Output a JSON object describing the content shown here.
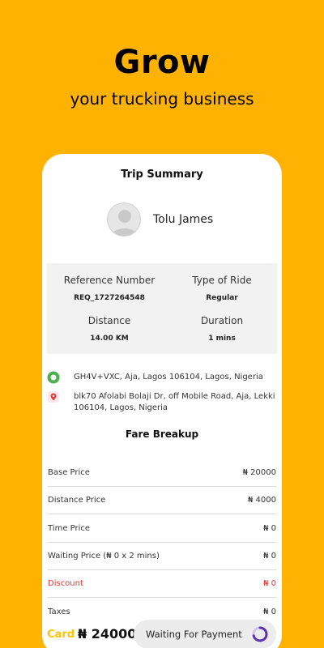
{
  "promo": {
    "headline": "Grow",
    "subline": "your trucking business"
  },
  "trip": {
    "title": "Trip Summary",
    "rider_name": "Tolu James",
    "details": {
      "reference_label": "Reference Number",
      "reference_value": "REQ_1727264548",
      "ride_type_label": "Type of Ride",
      "ride_type_value": "Regular",
      "distance_label": "Distance",
      "distance_value": "14.00 KM",
      "duration_label": "Duration",
      "duration_value": "1 mins"
    },
    "pickup": "GH4V+VXC, Aja, Lagos 106104, Lagos, Nigeria",
    "dropoff": "blk70 Afolabi Bolaji Dr, off Mobile Road, Aja, Lekki 106104, Lagos, Nigeria"
  },
  "fare": {
    "title": "Fare Breakup",
    "rows": [
      {
        "label": "Base Price",
        "value": "₦ 20000"
      },
      {
        "label": "Distance Price",
        "value": "₦ 4000"
      },
      {
        "label": "Time Price",
        "value": "₦ 0"
      },
      {
        "label": "Waiting Price (₦ 0 x 2 mins)",
        "value": "₦ 0"
      },
      {
        "label": "Discount",
        "value": "₦ 0"
      },
      {
        "label": "Taxes",
        "value": "₦ 0"
      }
    ]
  },
  "payment": {
    "method": "Card",
    "total": "₦ 24000",
    "status_label": "Waiting For Payment"
  },
  "colors": {
    "background": "#FFB300",
    "card_method": "#FFC400",
    "discount": "#e53935",
    "spinner": "#5E35B1",
    "pickup_icon": "#4CAF50",
    "dropoff_icon": "#e53935"
  },
  "icons": {
    "avatar": "user-placeholder-icon",
    "pickup": "pickup-dot-icon",
    "dropoff": "location-pin-icon",
    "spinner": "loading-spinner-icon"
  }
}
